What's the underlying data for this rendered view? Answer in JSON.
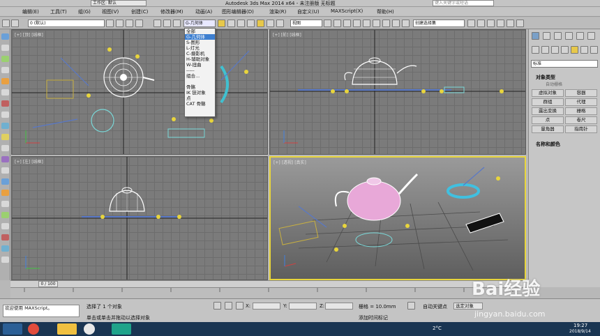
{
  "titlebar": {
    "workspace": "工作区: 默认",
    "title": "Autodesk 3ds Max  2014 x64  - 未注册版    无标题",
    "search_placeholder": "键入关键字或短语"
  },
  "menu": [
    "编辑(E)",
    "工具(T)",
    "组(G)",
    "视图(V)",
    "创建(C)",
    "修改器(M)",
    "动画(A)",
    "图形编辑器(D)",
    "渲染(R)",
    "自定义(U)",
    "MAXScript(X)",
    "帮助(H)"
  ],
  "toolbar": {
    "layer": "0 (默认)",
    "filter": "G-几何体",
    "coord": "视图",
    "selset": "创建选择集"
  },
  "dropdown": {
    "items": [
      "全部",
      "G-几何体",
      "S-图形",
      "L-灯光",
      "C-摄影机",
      "H-辅助对象",
      "W-扭曲",
      "-----",
      "组合...",
      "",
      "骨骼",
      "IK 链对象",
      "点",
      "CAT 骨骼"
    ],
    "selected_index": 1
  },
  "viewports": [
    {
      "label": "[+] [顶] [线框]"
    },
    {
      "label": "[+] [前] [线框]"
    },
    {
      "label": "[+] [左] [线框]"
    },
    {
      "label": "[+] [透视] [真实]"
    }
  ],
  "command_panel": {
    "dropdown": "标准",
    "section": "对象类型",
    "autogrid": "自动栅格",
    "buttons": [
      "虚拟对象",
      "容器",
      "群组",
      "代理",
      "露出变换",
      "栅格",
      "点",
      "卷尺",
      "量角器",
      "指南针"
    ],
    "section2": "名称和颜色"
  },
  "timeline": {
    "frame": "0 / 100"
  },
  "status": {
    "selected": "选择了 1 个对象",
    "prompt": "单击或单击并拖动以选择对象",
    "maxscript": "欢迎使用 MAXScript。",
    "x": "X:",
    "y": "Y:",
    "z": "Z:",
    "grid": "栅格 = 10.0mm",
    "autokey": "自动关键点",
    "setkey": "选定对象",
    "addtime": "添加时间标记"
  },
  "taskbar": {
    "temp": "2°C",
    "time": "19:27",
    "date": "2018/9/14"
  },
  "watermark": {
    "brand": "Bai经验",
    "url": "jingyan.baidu.com"
  }
}
